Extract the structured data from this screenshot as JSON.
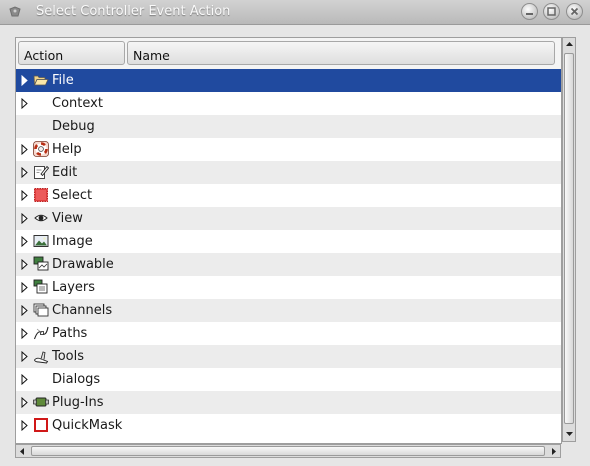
{
  "window": {
    "title": "Select Controller Event Action"
  },
  "columns": {
    "action": "Action",
    "name": "Name"
  },
  "rows": [
    {
      "label": "File",
      "icon": "folder-open-icon",
      "expander": true,
      "selected": true
    },
    {
      "label": "Context",
      "icon": "",
      "expander": true
    },
    {
      "label": "Debug",
      "icon": "",
      "expander": false
    },
    {
      "label": "Help",
      "icon": "help-lifebuoy-icon",
      "expander": true
    },
    {
      "label": "Edit",
      "icon": "edit-icon",
      "expander": true
    },
    {
      "label": "Select",
      "icon": "select-icon",
      "expander": true
    },
    {
      "label": "View",
      "icon": "eye-icon",
      "expander": true
    },
    {
      "label": "Image",
      "icon": "image-icon",
      "expander": true
    },
    {
      "label": "Drawable",
      "icon": "drawable-icon",
      "expander": true
    },
    {
      "label": "Layers",
      "icon": "layers-icon",
      "expander": true
    },
    {
      "label": "Channels",
      "icon": "channels-icon",
      "expander": true
    },
    {
      "label": "Paths",
      "icon": "paths-icon",
      "expander": true
    },
    {
      "label": "Tools",
      "icon": "tools-icon",
      "expander": true
    },
    {
      "label": "Dialogs",
      "icon": "",
      "expander": true
    },
    {
      "label": "Plug-Ins",
      "icon": "plugins-icon",
      "expander": true
    },
    {
      "label": "QuickMask",
      "icon": "quickmask-icon",
      "expander": true
    }
  ],
  "colors": {
    "selection": "#204a9f",
    "alt_row": "#ececec"
  }
}
